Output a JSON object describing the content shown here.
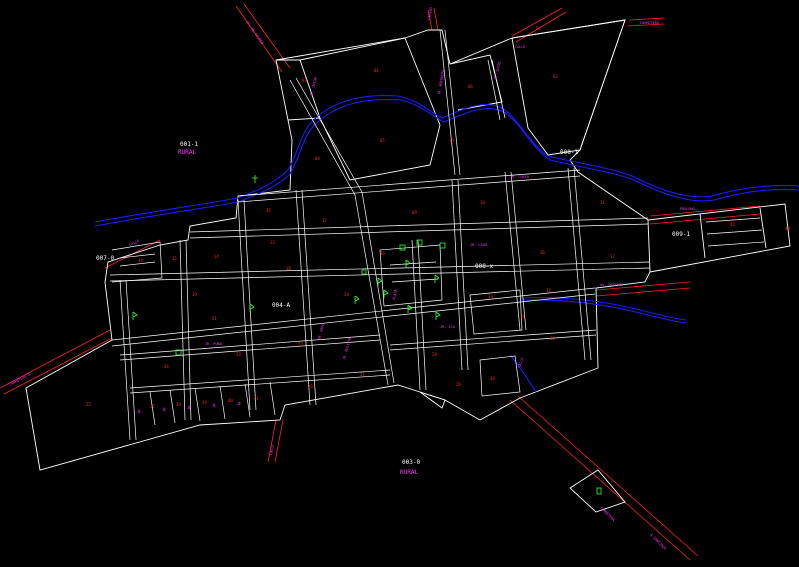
{
  "zones": [
    {
      "id": "zone-001-1",
      "code": "001-1",
      "sub": "RURAL"
    },
    {
      "id": "zone-003-0",
      "code": "003-0",
      "sub": "RURAL"
    },
    {
      "id": "zone-007-0",
      "code": "007-0",
      "sub": ""
    },
    {
      "id": "zone-008-1",
      "code": "008-1",
      "sub": ""
    },
    {
      "id": "zone-008-x",
      "code": "008-x",
      "sub": ""
    },
    {
      "id": "zone-009-1",
      "code": "009-1",
      "sub": ""
    },
    {
      "id": "zone-004-a",
      "code": "004-A",
      "sub": ""
    }
  ],
  "colors": {
    "background": "#000000",
    "block_outline": "#ffffff",
    "road_edge": "#ff2222",
    "river": "#1a1aff",
    "street_label": "#ff33ff",
    "symbol": "#33ff33",
    "lot_number": "#ff2222"
  },
  "symbols": [
    "tree-symbol",
    "flag-symbol",
    "plaza-symbol"
  ]
}
